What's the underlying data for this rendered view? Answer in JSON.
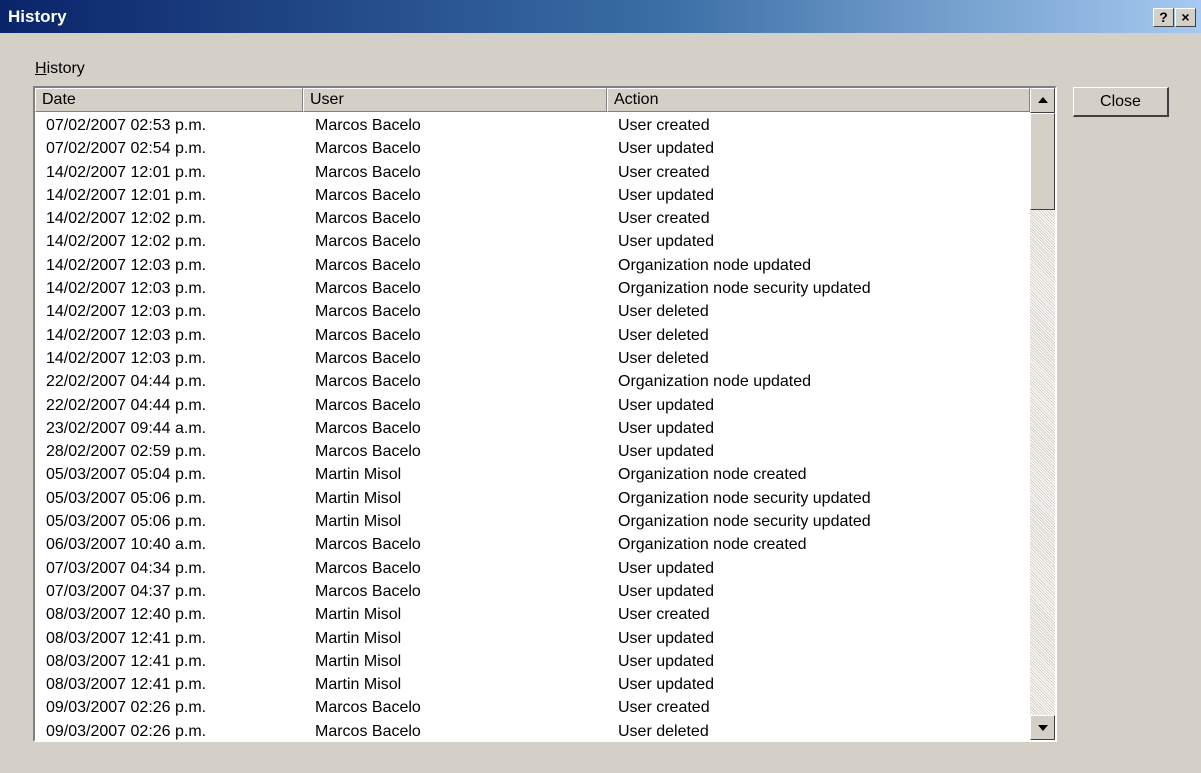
{
  "window": {
    "title": "History",
    "help_label": "?",
    "close_label": "×"
  },
  "group": {
    "label_accel": "H",
    "label_rest": "istory"
  },
  "table": {
    "columns": [
      "Date",
      "User",
      "Action"
    ],
    "rows": [
      [
        "07/02/2007 02:53 p.m.",
        "Marcos Bacelo",
        "User created"
      ],
      [
        "07/02/2007 02:54 p.m.",
        "Marcos Bacelo",
        "User updated"
      ],
      [
        "14/02/2007 12:01 p.m.",
        "Marcos Bacelo",
        "User created"
      ],
      [
        "14/02/2007 12:01 p.m.",
        "Marcos Bacelo",
        "User updated"
      ],
      [
        "14/02/2007 12:02 p.m.",
        "Marcos Bacelo",
        "User created"
      ],
      [
        "14/02/2007 12:02 p.m.",
        "Marcos Bacelo",
        "User updated"
      ],
      [
        "14/02/2007 12:03 p.m.",
        "Marcos Bacelo",
        "Organization node updated"
      ],
      [
        "14/02/2007 12:03 p.m.",
        "Marcos Bacelo",
        "Organization node security updated"
      ],
      [
        "14/02/2007 12:03 p.m.",
        "Marcos Bacelo",
        "User deleted"
      ],
      [
        "14/02/2007 12:03 p.m.",
        "Marcos Bacelo",
        "User deleted"
      ],
      [
        "14/02/2007 12:03 p.m.",
        "Marcos Bacelo",
        "User deleted"
      ],
      [
        "22/02/2007 04:44 p.m.",
        "Marcos Bacelo",
        "Organization node updated"
      ],
      [
        "22/02/2007 04:44 p.m.",
        "Marcos Bacelo",
        "User updated"
      ],
      [
        "23/02/2007 09:44 a.m.",
        "Marcos Bacelo",
        "User updated"
      ],
      [
        "28/02/2007 02:59 p.m.",
        "Marcos Bacelo",
        "User updated"
      ],
      [
        "05/03/2007 05:04 p.m.",
        "Martin Misol",
        "Organization node created"
      ],
      [
        "05/03/2007 05:06 p.m.",
        "Martin Misol",
        "Organization node security updated"
      ],
      [
        "05/03/2007 05:06 p.m.",
        "Martin Misol",
        "Organization node security updated"
      ],
      [
        "06/03/2007 10:40 a.m.",
        "Marcos Bacelo",
        "Organization node created"
      ],
      [
        "07/03/2007 04:34 p.m.",
        "Marcos Bacelo",
        "User updated"
      ],
      [
        "07/03/2007 04:37 p.m.",
        "Marcos Bacelo",
        "User updated"
      ],
      [
        "08/03/2007 12:40 p.m.",
        "Martin Misol",
        "User created"
      ],
      [
        "08/03/2007 12:41 p.m.",
        "Martin Misol",
        "User updated"
      ],
      [
        "08/03/2007 12:41 p.m.",
        "Martin Misol",
        "User updated"
      ],
      [
        "08/03/2007 12:41 p.m.",
        "Martin Misol",
        "User updated"
      ],
      [
        "09/03/2007 02:26 p.m.",
        "Marcos Bacelo",
        "User created"
      ],
      [
        "09/03/2007 02:26 p.m.",
        "Marcos Bacelo",
        "User deleted"
      ]
    ]
  },
  "buttons": {
    "close": "Close"
  },
  "icons": {
    "scroll_up": "arrow-up-icon",
    "scroll_down": "arrow-down-icon"
  }
}
